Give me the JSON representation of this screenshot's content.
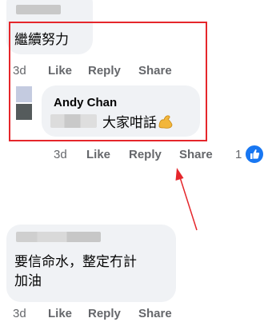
{
  "comments": [
    {
      "text": "繼續努力",
      "time": "3d",
      "like": "Like",
      "reply": "Reply",
      "share": "Share"
    },
    {
      "author": "Andy Chan",
      "text": "大家咁話",
      "emoji": "flexed-biceps-emoji",
      "time": "3d",
      "like": "Like",
      "reply": "Reply",
      "share": "Share",
      "reaction_count": "1",
      "reaction_icon": "thumbs-up-icon"
    },
    {
      "text_line1": "要信命水，整定冇計",
      "text_line2": "加油",
      "time": "3d",
      "like": "Like",
      "reply": "Reply",
      "share": "Share"
    }
  ],
  "annotation": {
    "box_color": "#e5262b",
    "arrow_color": "#e5262b"
  },
  "colors": {
    "bubble": "#f0f2f5",
    "meta_text": "#65676b",
    "accent": "#1877f2"
  }
}
